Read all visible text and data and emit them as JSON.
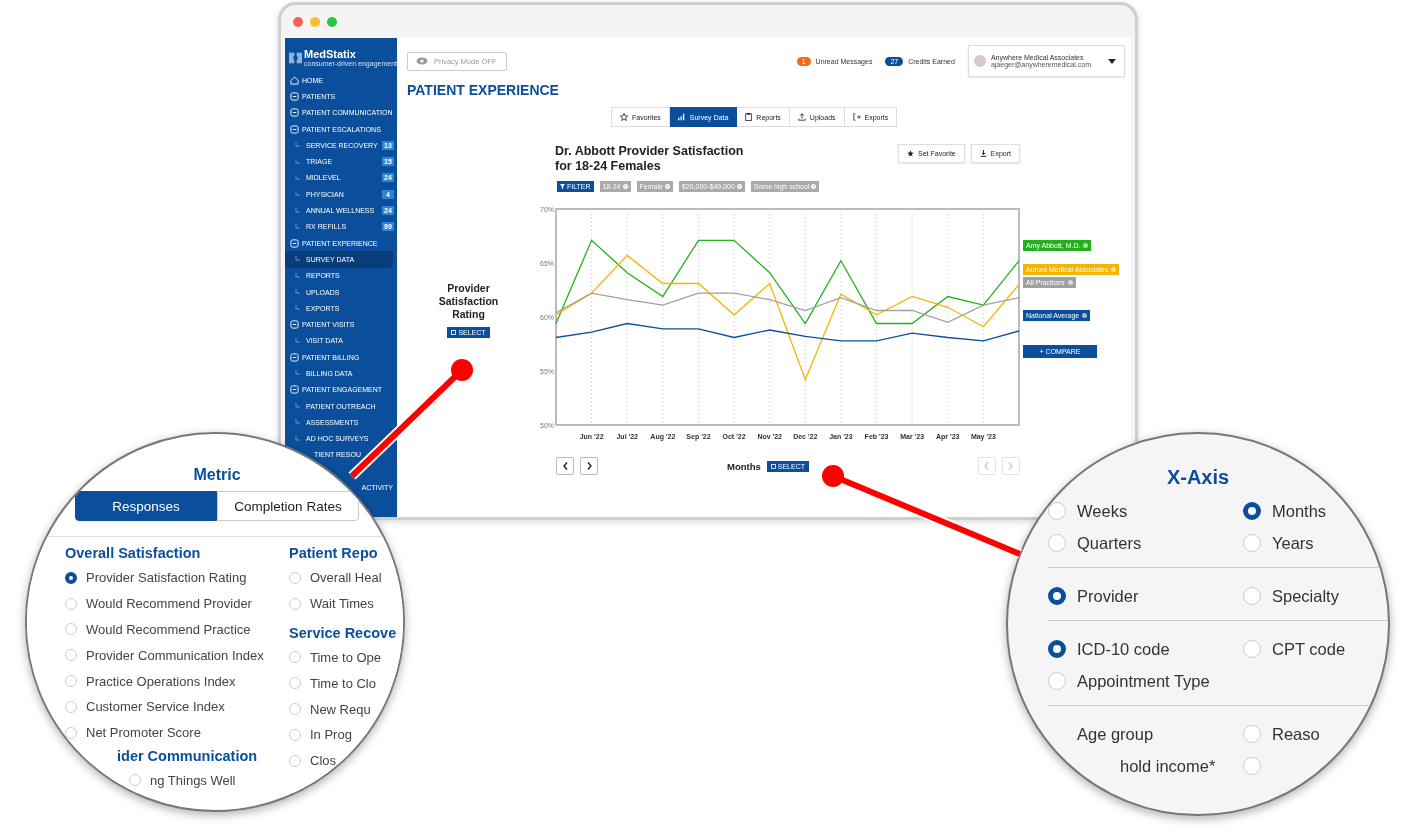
{
  "brand": {
    "name": "MedStatix",
    "tagline": "consumer-driven engagement"
  },
  "sidebar": {
    "items": [
      {
        "kind": "home",
        "label": "HOME",
        "selected": false
      },
      {
        "kind": "section",
        "label": "PATIENTS",
        "selected": false
      },
      {
        "kind": "section",
        "label": "PATIENT COMMUNICATION",
        "selected": false
      },
      {
        "kind": "section",
        "label": "PATIENT ESCALATIONS",
        "selected": false
      },
      {
        "kind": "sub",
        "label": "SERVICE RECOVERY",
        "badge": "13",
        "selected": false
      },
      {
        "kind": "sub",
        "label": "TRIAGE",
        "badge": "15",
        "selected": false
      },
      {
        "kind": "sub",
        "label": "MIDLEVEL",
        "badge": "24",
        "selected": false
      },
      {
        "kind": "sub",
        "label": "PHYSICIAN",
        "badge": "4",
        "selected": false
      },
      {
        "kind": "sub",
        "label": "ANNUAL WELLNESS",
        "badge": "24",
        "selected": false
      },
      {
        "kind": "sub",
        "label": "RX REFILLS",
        "badge": "99",
        "selected": false
      },
      {
        "kind": "section",
        "label": "PATIENT EXPERIENCE",
        "selected": false
      },
      {
        "kind": "sub",
        "label": "SURVEY DATA",
        "selected": true
      },
      {
        "kind": "sub",
        "label": "REPORTS",
        "selected": false
      },
      {
        "kind": "sub",
        "label": "UPLOADS",
        "selected": false
      },
      {
        "kind": "sub",
        "label": "EXPORTS",
        "selected": false
      },
      {
        "kind": "section",
        "label": "PATIENT VISITS",
        "selected": false
      },
      {
        "kind": "sub",
        "label": "VISIT DATA",
        "selected": false
      },
      {
        "kind": "section",
        "label": "PATIENT BILLING",
        "selected": false
      },
      {
        "kind": "sub",
        "label": "BILLING DATA",
        "selected": false
      },
      {
        "kind": "section",
        "label": "PATIENT ENGAGEMENT",
        "selected": false
      },
      {
        "kind": "sub",
        "label": "PATIENT OUTREACH",
        "selected": false
      },
      {
        "kind": "sub",
        "label": "ASSESSMENTS",
        "selected": false
      },
      {
        "kind": "sub",
        "label": "AD HOC SURVEYS",
        "selected": false
      },
      {
        "kind": "partial",
        "label": "TIENT RESOU",
        "selected": false
      },
      {
        "kind": "tail",
        "label": "ACTIVITY",
        "selected": false
      }
    ]
  },
  "topbar": {
    "privacy_button": "Privacy Mode OFF",
    "messages": {
      "count": "1",
      "label": "Unread Messages"
    },
    "credits": {
      "count": "27",
      "label": "Credits Earned"
    },
    "account": {
      "name": "Anywhere Medical Associates",
      "email": "ajaeger@anywheremedical.com"
    }
  },
  "page_title": "PATIENT EXPERIENCE",
  "tabs": [
    {
      "kind": "star",
      "label": "Favorites",
      "selected": false
    },
    {
      "kind": "chart",
      "label": "Survey Data",
      "selected": true
    },
    {
      "kind": "report",
      "label": "Reports",
      "selected": false
    },
    {
      "kind": "upload",
      "label": "Uploads",
      "selected": false
    },
    {
      "kind": "export",
      "label": "Exports",
      "selected": false
    }
  ],
  "metric_panel": {
    "label": "Provider Satisfaction Rating",
    "select_button": "SELECT"
  },
  "report": {
    "title_lines": [
      "Dr. Abbott Provider Satisfaction",
      "for 18-24 Females"
    ],
    "buttons": [
      {
        "kind": "star",
        "label": "Set Favorite"
      },
      {
        "kind": "download",
        "label": "Export"
      }
    ],
    "filters": [
      {
        "kind": "filter",
        "label": "FILTER"
      },
      {
        "kind": "chip",
        "label": "18-24"
      },
      {
        "kind": "chip",
        "label": "Female"
      },
      {
        "kind": "chip",
        "label": "$20,000-$49,000"
      },
      {
        "kind": "chip",
        "label": "Some high school"
      }
    ],
    "chart_data": {
      "type": "line",
      "grid": true,
      "categories": [
        null,
        "Jun '22",
        "Jul '22",
        "Aug '22",
        "Sep '22",
        "Oct '22",
        "Nov '22",
        "Dec '22",
        "Jan '23",
        "Feb '23",
        "Mar '23",
        "Apr '23",
        "May '23",
        null
      ],
      "ylim": [
        50,
        70
      ],
      "yticks": [
        {
          "value": 70,
          "label": "70%"
        },
        {
          "value": 65,
          "label": "65%"
        },
        {
          "value": 60,
          "label": "60%"
        },
        {
          "value": 55,
          "label": "55%"
        },
        {
          "value": 50,
          "label": "50%"
        }
      ],
      "series": [
        {
          "name": "Amy Abbott, M.D.",
          "color": "#22b01e",
          "values": [
            59.4,
            67.1,
            64.1,
            61.9,
            67.1,
            67.1,
            64.1,
            59.4,
            65.2,
            59.4,
            59.4,
            61.9,
            61.1,
            65.2
          ]
        },
        {
          "name": "Aurora Medical Associates",
          "color": "#f5b400",
          "values": [
            60.2,
            62.2,
            65.7,
            63.1,
            63.1,
            60.2,
            63.1,
            54.2,
            62.1,
            60.2,
            61.9,
            60.9,
            59.1,
            63.0
          ]
        },
        {
          "name": "All Practices",
          "color": "#a0a0a0",
          "values": [
            60.4,
            62.2,
            61.6,
            61.1,
            62.2,
            62.2,
            61.6,
            60.6,
            61.8,
            60.6,
            60.6,
            59.5,
            61.1,
            61.8
          ]
        },
        {
          "name": "National Average",
          "color": "#0b4f9c",
          "values": [
            58.1,
            58.6,
            59.4,
            58.9,
            58.9,
            58.1,
            58.8,
            58.2,
            57.8,
            57.8,
            58.5,
            58.1,
            57.8,
            58.7
          ]
        }
      ]
    },
    "compare_button": "+ COMPARE",
    "x_axis_label": "Months",
    "x_axis_button": "SELECT"
  },
  "metric_popup": {
    "title": "Metric",
    "toggle": [
      {
        "label": "Responses",
        "selected": true
      },
      {
        "label": "Completion Rates",
        "selected": false
      }
    ],
    "columns": [
      [
        {
          "heading": "Overall Satisfaction",
          "options": [
            {
              "label": "Provider Satisfaction Rating",
              "selected": true
            },
            {
              "label": "Would Recommend Provider",
              "selected": false
            },
            {
              "label": "Would Recommend Practice",
              "selected": false
            },
            {
              "label": "Provider Communication Index",
              "selected": false
            },
            {
              "label": "Practice Operations Index",
              "selected": false
            },
            {
              "label": "Customer Service Index",
              "selected": false
            },
            {
              "label": "Net Promoter Score",
              "selected": false
            }
          ]
        },
        {
          "heading": "ider Communication",
          "options": [
            {
              "label": "ng Things Well",
              "selected": false
            }
          ]
        }
      ],
      [
        {
          "heading": "Patient Repo",
          "options": [
            {
              "label": "Overall Heal",
              "selected": false
            },
            {
              "label": "Wait Times",
              "selected": false
            }
          ]
        },
        {
          "heading": "Service Recove",
          "options": [
            {
              "label": "Time to Ope",
              "selected": false
            },
            {
              "label": "Time to Clo",
              "selected": false
            },
            {
              "label": "New Requ",
              "selected": false
            },
            {
              "label": "In Prog",
              "selected": false
            },
            {
              "label": "Clos",
              "selected": false
            }
          ]
        }
      ]
    ]
  },
  "xaxis_popup": {
    "title": "X-Axis",
    "groups": [
      [
        {
          "label": "Weeks",
          "selected": false
        },
        {
          "label": "Months",
          "selected": true
        },
        {
          "label": "Quarters",
          "selected": false
        },
        {
          "label": "Years",
          "selected": false
        }
      ],
      [
        {
          "label": "Provider",
          "selected": true
        },
        {
          "label": "Specialty",
          "selected": false
        }
      ],
      [
        {
          "label": "ICD-10 code",
          "selected": true
        },
        {
          "label": "CPT code",
          "selected": false
        },
        {
          "label": "Appointment Type",
          "selected": false
        }
      ],
      [
        {
          "label": "Age group"
        },
        {
          "label": "Reaso",
          "selected": false
        },
        {
          "label": "hold income*"
        },
        {
          "selected": false
        }
      ]
    ]
  }
}
